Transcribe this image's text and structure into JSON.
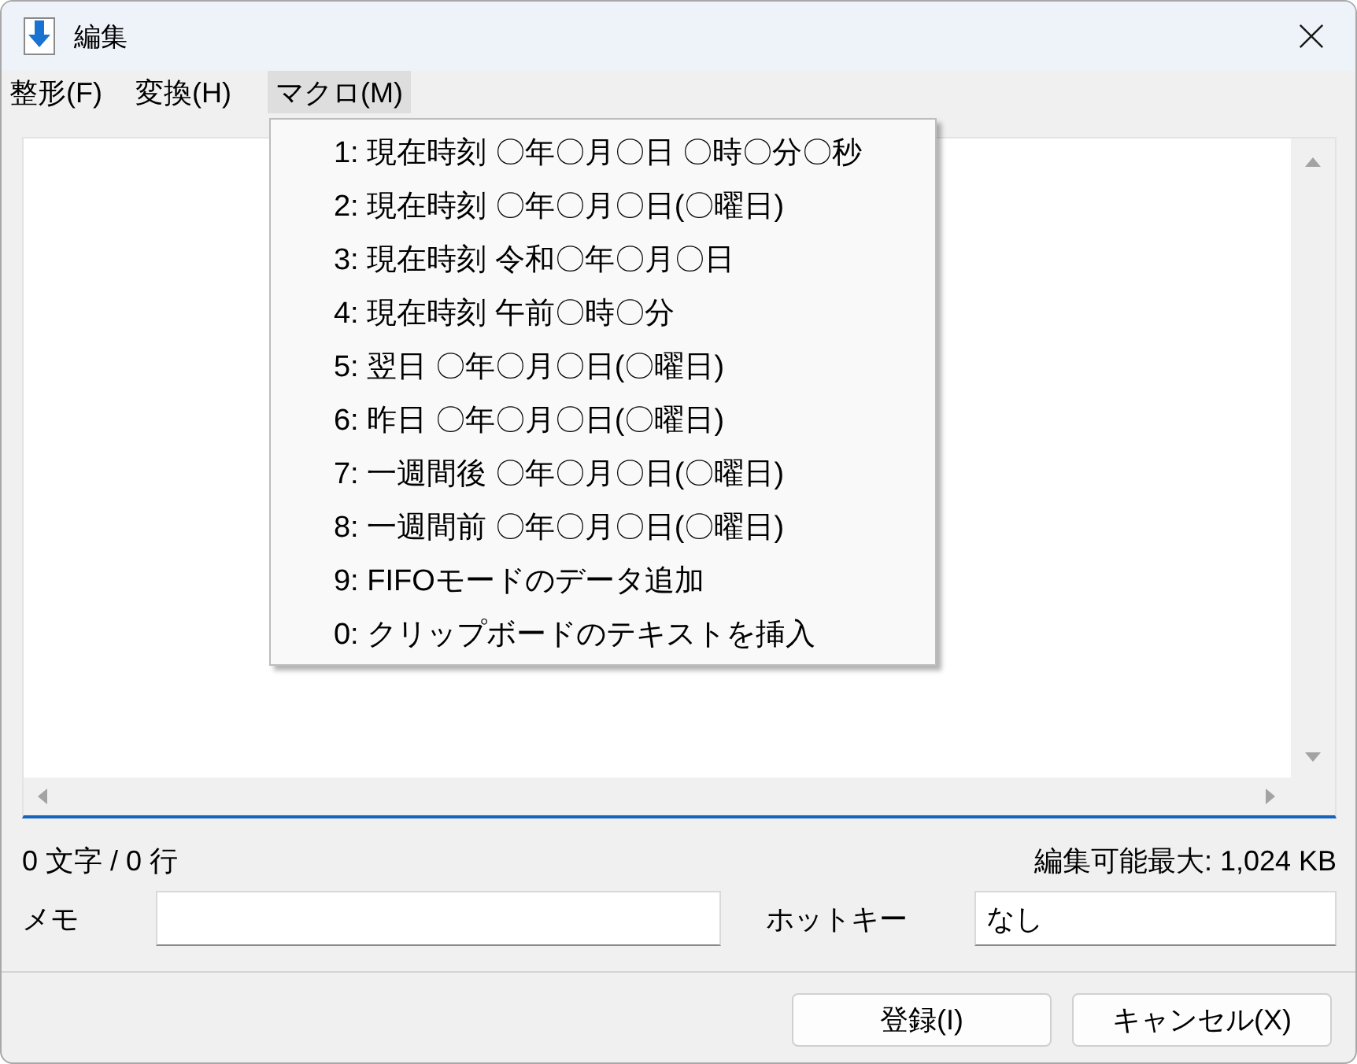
{
  "window": {
    "title": "編集"
  },
  "menu_bar": [
    {
      "label": "整形(F)",
      "selected": false
    },
    {
      "label": "変換(H)",
      "selected": false
    },
    {
      "label": "マクロ(M)",
      "selected": true
    }
  ],
  "dropdown": {
    "items": [
      "1: 現在時刻 〇年〇月〇日 〇時〇分〇秒",
      "2: 現在時刻 〇年〇月〇日(〇曜日)",
      "3: 現在時刻 令和〇年〇月〇日",
      "4: 現在時刻 午前〇時〇分",
      "5: 翌日 〇年〇月〇日(〇曜日)",
      "6: 昨日 〇年〇月〇日(〇曜日)",
      "7: 一週間後 〇年〇月〇日(〇曜日)",
      "8: 一週間前 〇年〇月〇日(〇曜日)",
      "9: FIFOモードのデータ追加",
      "0: クリップボードのテキストを挿入"
    ]
  },
  "status": {
    "count": "0 文字 / 0 行",
    "max_size": "編集可能最大: 1,024 KB"
  },
  "memo": {
    "label": "メモ"
  },
  "hotkey": {
    "label": "ホットキー",
    "value": "なし"
  },
  "buttons": [
    "登録(I)",
    "キャンセル(X)"
  ]
}
